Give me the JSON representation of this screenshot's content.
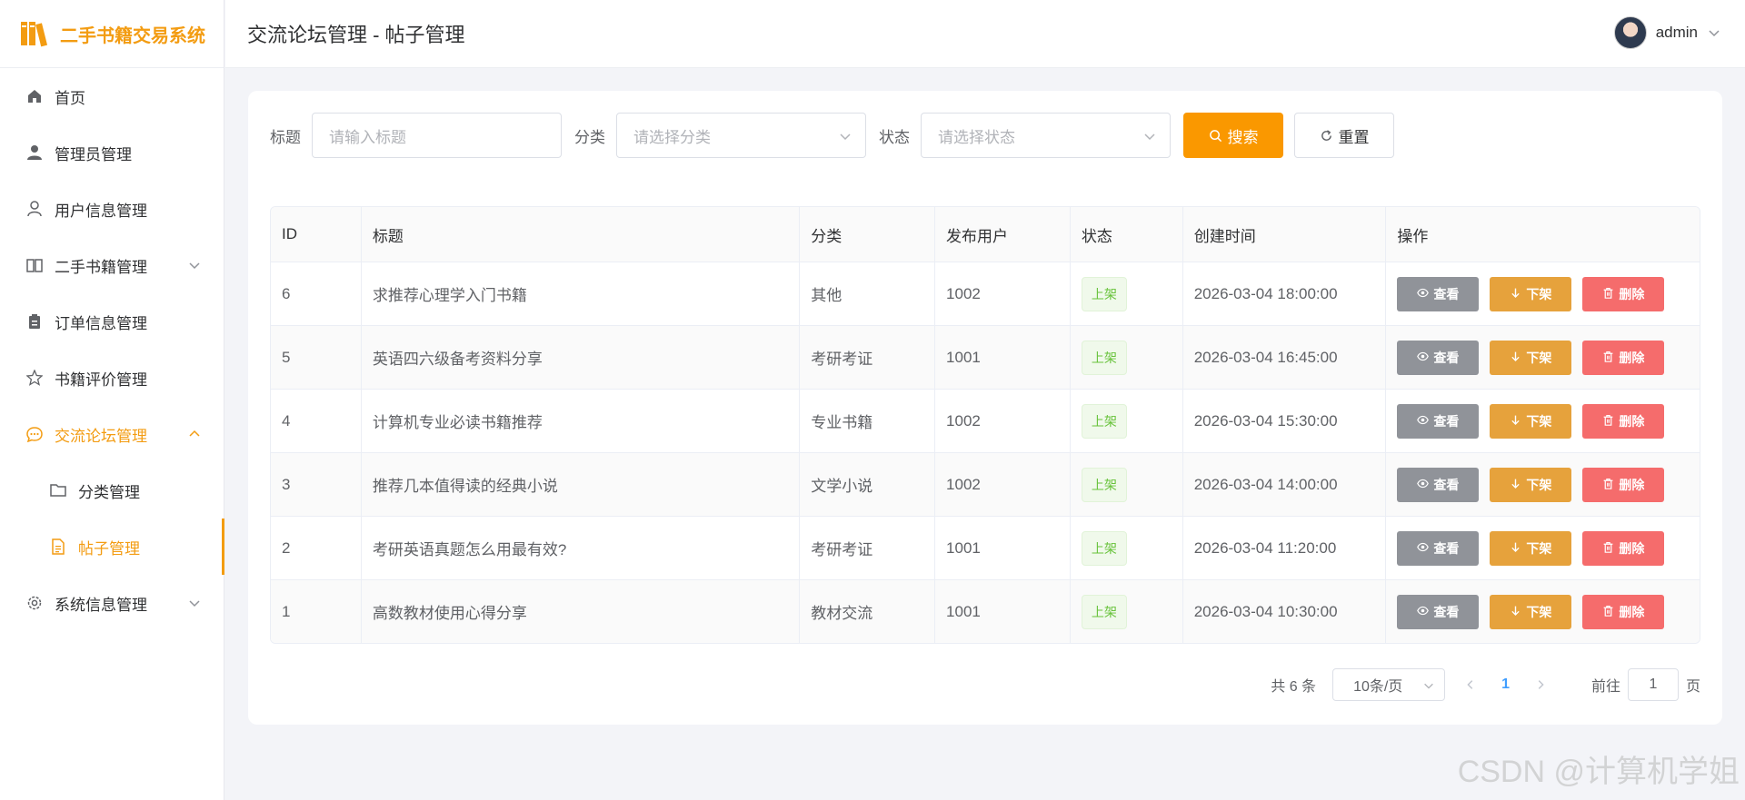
{
  "app": {
    "title": "二手书籍交易系统"
  },
  "sidebar": {
    "items": [
      {
        "label": "首页"
      },
      {
        "label": "管理员管理"
      },
      {
        "label": "用户信息管理"
      },
      {
        "label": "二手书籍管理"
      },
      {
        "label": "订单信息管理"
      },
      {
        "label": "书籍评价管理"
      },
      {
        "label": "交流论坛管理"
      },
      {
        "label": "分类管理"
      },
      {
        "label": "帖子管理"
      },
      {
        "label": "系统信息管理"
      }
    ]
  },
  "header": {
    "title": "交流论坛管理 - 帖子管理",
    "user": "admin"
  },
  "filter": {
    "title_label": "标题",
    "title_placeholder": "请输入标题",
    "category_label": "分类",
    "category_placeholder": "请选择分类",
    "status_label": "状态",
    "status_placeholder": "请选择状态",
    "search_label": "搜索",
    "reset_label": "重置"
  },
  "table": {
    "headers": [
      "ID",
      "标题",
      "分类",
      "发布用户",
      "状态",
      "创建时间",
      "操作"
    ],
    "rows": [
      {
        "id": "6",
        "title": "求推荐心理学入门书籍",
        "category": "其他",
        "user": "1002",
        "status": "上架",
        "created": "2026-03-04 18:00:00"
      },
      {
        "id": "5",
        "title": "英语四六级备考资料分享",
        "category": "考研考证",
        "user": "1001",
        "status": "上架",
        "created": "2026-03-04 16:45:00"
      },
      {
        "id": "4",
        "title": "计算机专业必读书籍推荐",
        "category": "专业书籍",
        "user": "1002",
        "status": "上架",
        "created": "2026-03-04 15:30:00"
      },
      {
        "id": "3",
        "title": "推荐几本值得读的经典小说",
        "category": "文学小说",
        "user": "1002",
        "status": "上架",
        "created": "2026-03-04 14:00:00"
      },
      {
        "id": "2",
        "title": "考研英语真题怎么用最有效?",
        "category": "考研考证",
        "user": "1001",
        "status": "上架",
        "created": "2026-03-04 11:20:00"
      },
      {
        "id": "1",
        "title": "高数教材使用心得分享",
        "category": "教材交流",
        "user": "1001",
        "status": "上架",
        "created": "2026-03-04 10:30:00"
      }
    ],
    "actions": {
      "view": "查看",
      "down": "下架",
      "delete": "删除"
    }
  },
  "pagination": {
    "total": "共 6 条",
    "page_size": "10条/页",
    "current": "1",
    "goto_label": "前往",
    "goto_value": "1",
    "page_suffix": "页"
  },
  "watermark": "CSDN @计算机学姐",
  "colors": {
    "accent": "#f39c12",
    "search": "#fa9800",
    "view": "#909399",
    "down": "#e6a23c",
    "delete": "#f56c6c",
    "tag": "#67c23a",
    "page_active": "#409eff"
  }
}
